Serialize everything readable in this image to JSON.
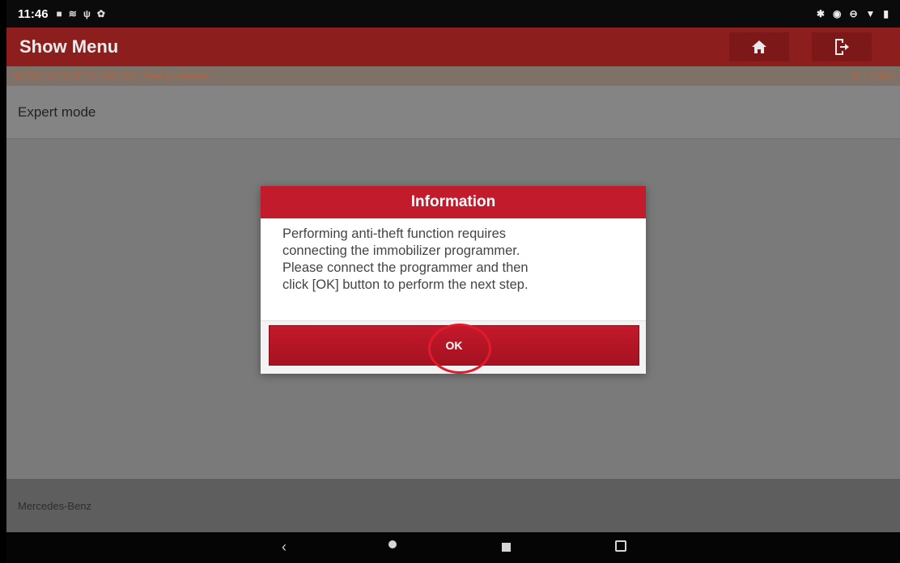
{
  "status": {
    "time": "11:46",
    "icons_left": [
      "notification-icon",
      "signal-icon",
      "usb-icon",
      "settings-icon"
    ],
    "icons_right": [
      "bluetooth-icon",
      "vpn-icon",
      "dnd-icon",
      "wifi-icon",
      "battery-icon"
    ]
  },
  "titlebar": {
    "title": "Show Menu",
    "home_icon": "home-icon",
    "exit_icon": "exit-icon"
  },
  "breadcrumb": {
    "path": "MERCEDES-BENZ V49.60 > Theft protection",
    "voltage": "12.06V"
  },
  "menu": {
    "item": "Expert mode"
  },
  "dialog": {
    "title": "Information",
    "message_lines": [
      "Performing anti-theft function requires",
      "connecting the immobilizer programmer.",
      "Please connect the programmer and then",
      "click [OK] button to perform the next step."
    ],
    "ok_label": "OK"
  },
  "footer": {
    "brand": "Mercedes-Benz"
  },
  "colors": {
    "titlebar": "#8d1e1e",
    "dialog_header": "#c21b2c",
    "ok_button": "#b3172a",
    "highlight": "#e21a2b"
  }
}
